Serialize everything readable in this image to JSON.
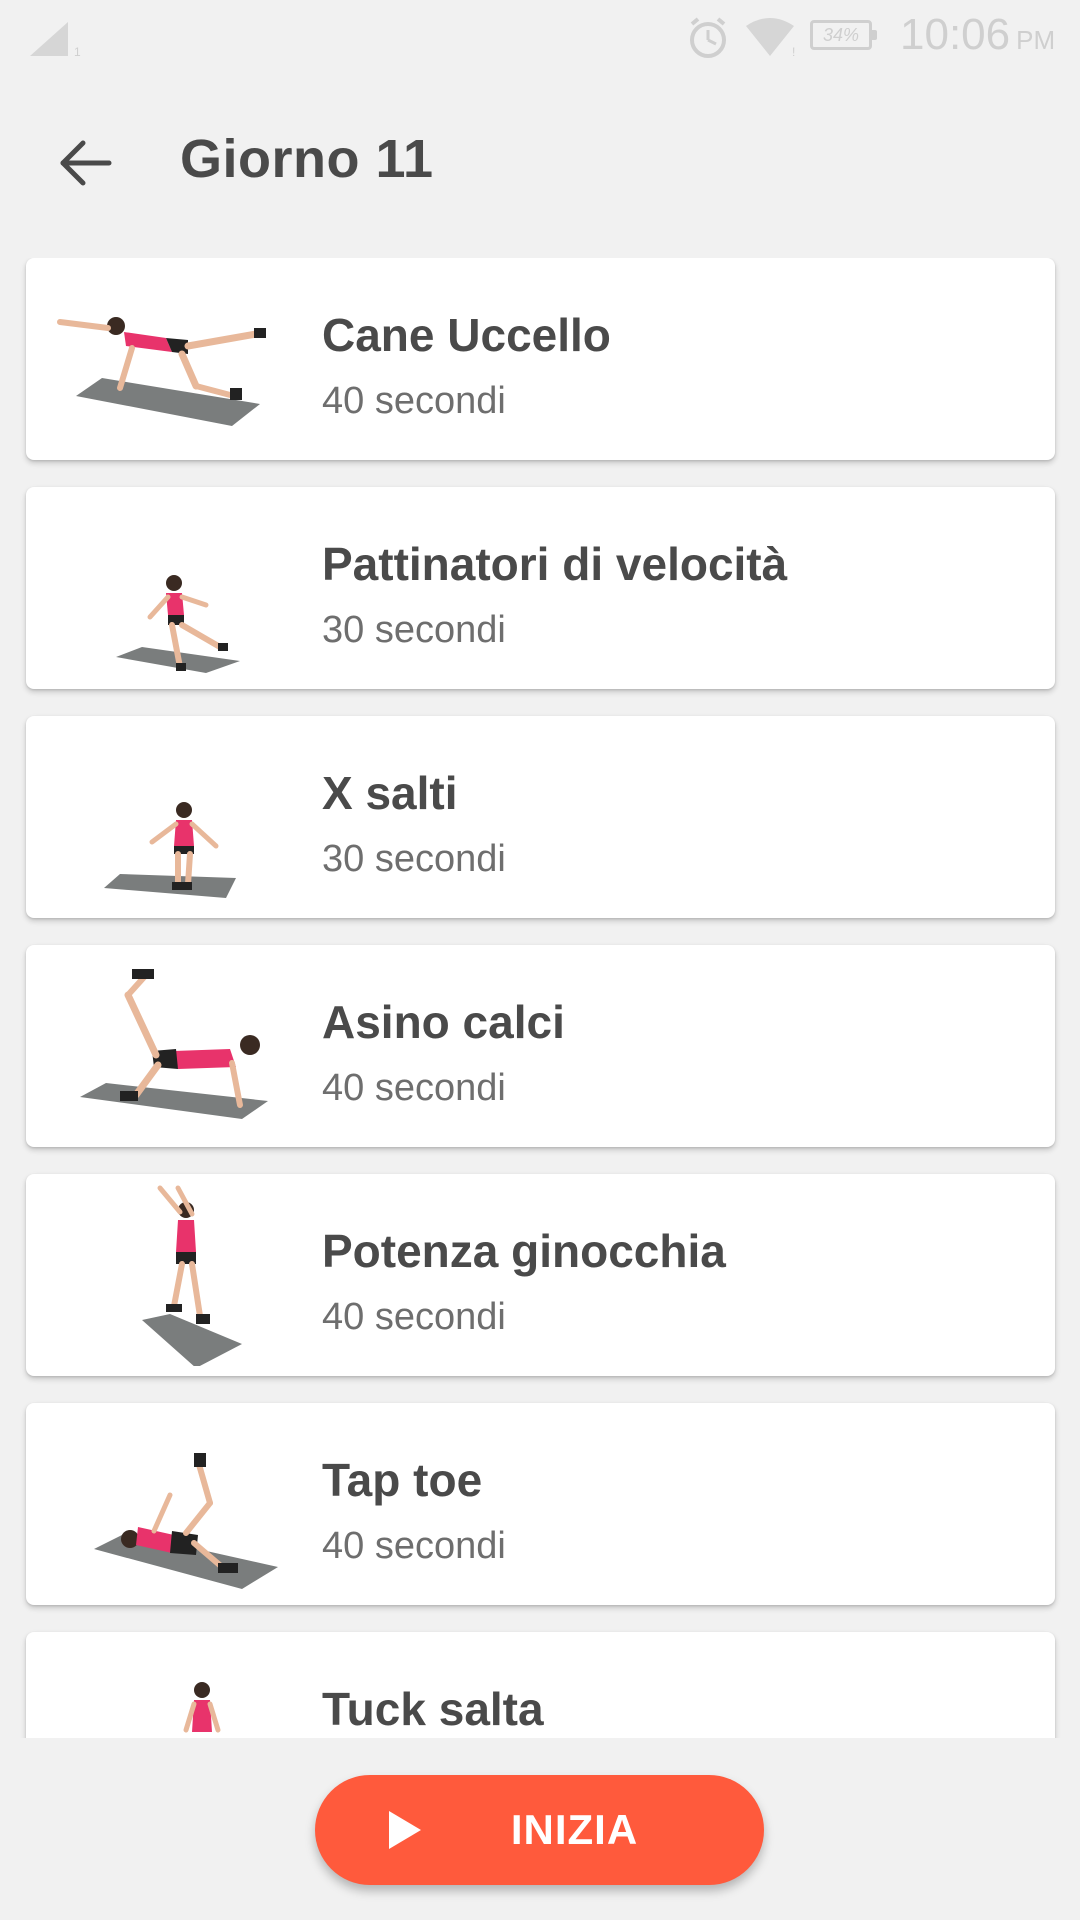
{
  "status_bar": {
    "battery": "34%",
    "time": "10:06",
    "ampm": "PM"
  },
  "header": {
    "title": "Giorno 11"
  },
  "exercises": [
    {
      "name": "Cane Uccello",
      "duration": "40 secondi"
    },
    {
      "name": "Pattinatori di velocità",
      "duration": "30 secondi"
    },
    {
      "name": "X salti",
      "duration": "30 secondi"
    },
    {
      "name": "Asino calci",
      "duration": "40 secondi"
    },
    {
      "name": "Potenza ginocchia",
      "duration": "40 secondi"
    },
    {
      "name": "Tap toe",
      "duration": "40 secondi"
    },
    {
      "name": "Tuck salta",
      "duration": ""
    }
  ],
  "start_button": {
    "label": "INIZIA"
  },
  "colors": {
    "accent": "#ff5a3c",
    "background": "#f1f1f1",
    "card": "#ffffff",
    "mat": "#7a7d7d",
    "top": "#e8336b"
  }
}
